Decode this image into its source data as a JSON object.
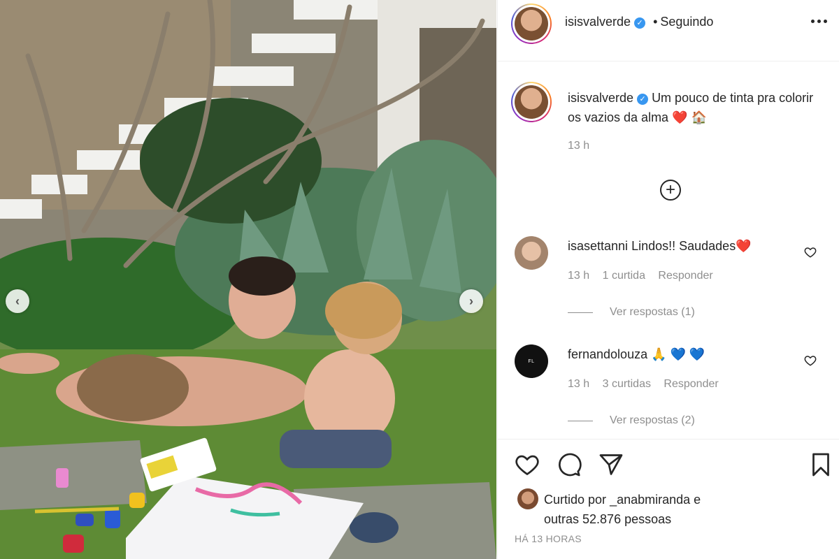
{
  "post_author": {
    "username": "isisvalverde",
    "follow_status": "Seguindo",
    "separator": "•"
  },
  "caption": {
    "username": "isisvalverde",
    "text": "Um pouco de tinta pra colorir os vazios da alma",
    "emoji": "❤️ 🏠",
    "time": "13 h"
  },
  "comments": [
    {
      "username": "isasettanni",
      "text": "Lindos!! Saudades❤️",
      "time": "13 h",
      "likes": "1 curtida",
      "reply_label": "Responder",
      "view_replies": "Ver respostas (1)"
    },
    {
      "username": "fernandolouza",
      "text": "🙏 💙 💙",
      "time": "13 h",
      "likes": "3 curtidas",
      "reply_label": "Responder",
      "view_replies": "Ver respostas (2)"
    }
  ],
  "likes": {
    "prefix": "Curtido por",
    "user": "_anabmiranda",
    "conjunction": "e",
    "others": "outras 52.876 pessoas"
  },
  "timestamp": "HÁ 13 HORAS",
  "icons": {
    "more": "more-options-icon",
    "add_comment": "plus-circle-icon",
    "like": "heart-icon",
    "comment": "comment-icon",
    "share": "send-icon",
    "save": "bookmark-icon"
  },
  "colors": {
    "accent": "#3897f0",
    "muted": "#8e8e8e",
    "text": "#262626"
  }
}
